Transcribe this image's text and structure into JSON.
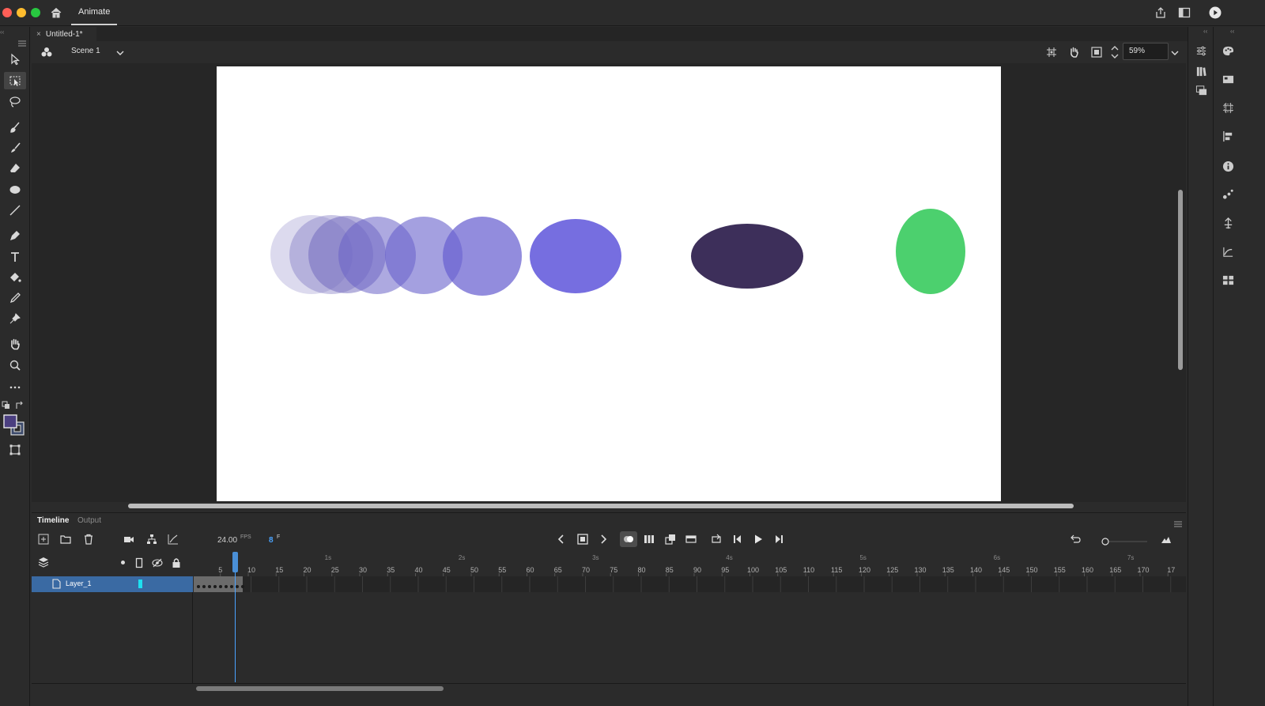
{
  "titlebar": {
    "app_name": "Animate",
    "traffic_colors": [
      "#ff5f57",
      "#febc2e",
      "#28c840"
    ],
    "icons": [
      "home-icon",
      "share-icon",
      "layout-icon",
      "play-circle-icon"
    ]
  },
  "document": {
    "tab_title": "Untitled-1*",
    "close_glyph": "×",
    "scene": "Scene 1",
    "zoom": "59%"
  },
  "tools": [
    "selection-icon",
    "free-transform-icon",
    "lasso-icon",
    "paint-brush-icon",
    "brush-icon",
    "eraser-icon",
    "oval-icon",
    "line-icon",
    "pen-icon",
    "text-icon",
    "paint-bucket-icon",
    "eyedropper-icon",
    "pin-icon",
    "hand-icon",
    "zoom-icon",
    "more-tools-icon",
    "swap-colors-icon",
    "stroke-fill-color-icon",
    "asset-warp-icon"
  ],
  "stage": {
    "background": "#ffffff",
    "shapes": [
      {
        "name": "onion-skin-ellipse-1",
        "color": "#8c86c8",
        "opacity": 0.3
      },
      {
        "name": "onion-skin-ellipse-2",
        "color": "#7a73c0",
        "opacity": 0.4
      },
      {
        "name": "onion-skin-ellipse-3",
        "color": "#6e66bc",
        "opacity": 0.5
      },
      {
        "name": "onion-skin-ellipse-4",
        "color": "#6a62c6",
        "opacity": 0.55
      },
      {
        "name": "onion-skin-ellipse-5",
        "color": "#6760cc",
        "opacity": 0.6
      },
      {
        "name": "onion-skin-ellipse-6",
        "color": "#6860d0",
        "opacity": 0.72
      },
      {
        "name": "current-ellipse",
        "color": "#766ee0",
        "opacity": 1
      },
      {
        "name": "dark-ellipse",
        "color": "#3d2f5a",
        "opacity": 1
      },
      {
        "name": "green-ellipse",
        "color": "#4cd06e",
        "opacity": 1
      }
    ]
  },
  "timeline": {
    "tabs": [
      "Timeline",
      "Output"
    ],
    "fps": "24.00",
    "fps_unit": "FPS",
    "current_frame": "8",
    "frame_unit": "F",
    "layer_name": "Layer_1",
    "layer_color": "#1ee0f0",
    "seconds": [
      "1s",
      "2s",
      "3s",
      "4s",
      "5s",
      "6s",
      "7s"
    ],
    "frame_ticks": [
      "5",
      "10",
      "15",
      "20",
      "25",
      "30",
      "35",
      "40",
      "45",
      "50",
      "55",
      "60",
      "65",
      "70",
      "75",
      "80",
      "85",
      "90",
      "95",
      "100",
      "105",
      "110",
      "115",
      "120",
      "125",
      "130",
      "135",
      "140",
      "145",
      "150",
      "155",
      "160",
      "165",
      "170",
      "17"
    ],
    "accent": "#4aa3ff"
  },
  "right_panel": {
    "col1_icons": [
      "properties-icon",
      "library-icon",
      "assets-icon"
    ],
    "col2_icons": [
      "color-icon",
      "swatches-icon",
      "transform-icon",
      "align-icon",
      "info-icon",
      "motion-presets-icon",
      "code-snippets-icon",
      "motion-editor-icon",
      "components-icon"
    ]
  }
}
